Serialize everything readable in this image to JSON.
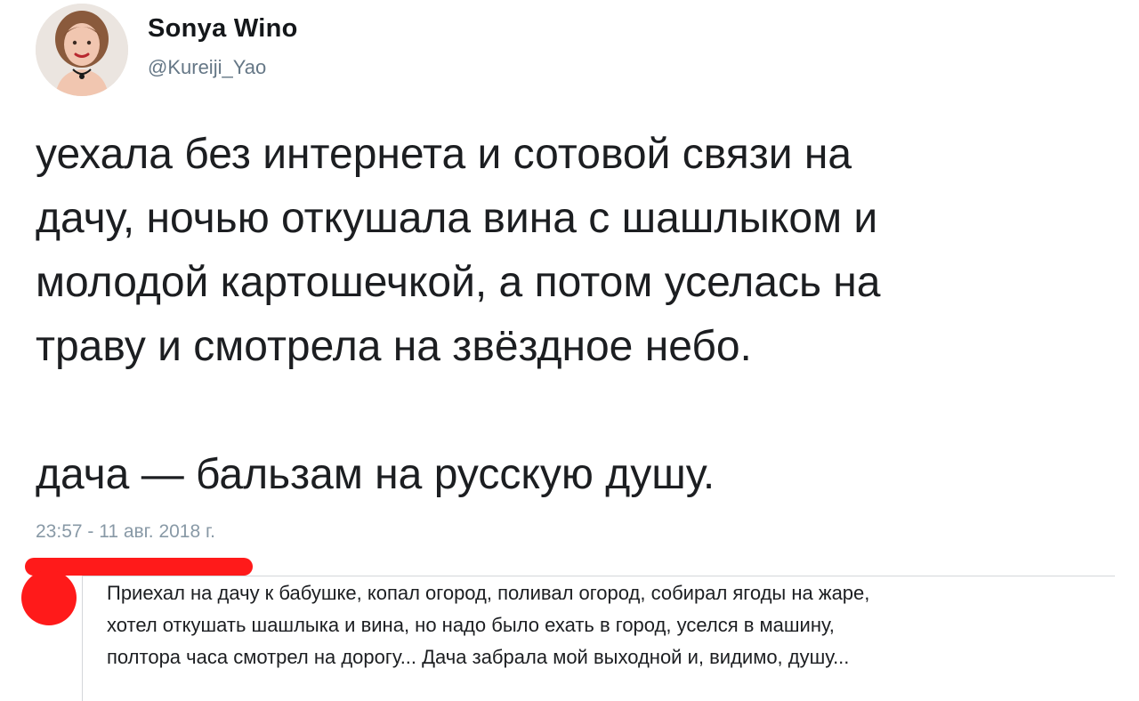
{
  "tweet": {
    "author": {
      "display_name": "Sonya Wino",
      "handle": "@Kureiji_Yao",
      "avatar_icon": "profile-photo"
    },
    "text_lines": [
      "уехала без интернета и сотовой связи на",
      "дачу, ночью откушала вина с шашлыком и",
      "молодой картошечкой, а потом уселась на",
      "траву и смотрела на звёздное небо."
    ],
    "text_line_2": "дача — бальзам на русскую душу.",
    "timestamp": "23:57 - 11 авг. 2018 г."
  },
  "reply": {
    "avatar_color": "#ff1a1a",
    "text_lines": [
      "Приехал на дачу к бабушке, копал огород, поливал огород, собирал ягоды на жаре,",
      "хотел откушать шашлыка и вина, но надо было ехать в город, уселся в машину,",
      "полтора часа смотрел на дорогу... Дача забрала мой выходной и, видимо, душу..."
    ]
  },
  "colors": {
    "text": "#1c1e21",
    "secondary": "#657786",
    "timestamp": "#8899a6",
    "reply_accent": "#ff1a1a"
  }
}
